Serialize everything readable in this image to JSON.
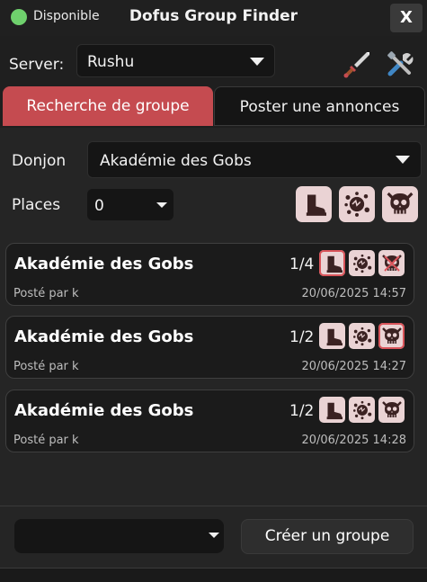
{
  "titlebar": {
    "status": "Disponible",
    "status_color": "#6fd06d",
    "title": "Dofus Group Finder",
    "close_label": "X"
  },
  "server": {
    "label": "Server:",
    "value": "Rushu",
    "icons": [
      "sword-icon",
      "tools-icon"
    ]
  },
  "tabs": [
    {
      "label": "Recherche de groupe",
      "active": true
    },
    {
      "label": "Poster une annonces",
      "active": false
    }
  ],
  "filters": {
    "donjon_label": "Donjon",
    "donjon_value": "Akadémie des Gobs",
    "places_label": "Places",
    "places_value": "0",
    "role_icons": [
      "boot-icon",
      "splat-icon",
      "skull-icon"
    ]
  },
  "listings": [
    {
      "title": "Akadémie des Gobs",
      "count": "1/4",
      "author": "Posté par k",
      "date": "20/06/2025 14:57"
    },
    {
      "title": "Akadémie des Gobs",
      "count": "1/2",
      "author": "Posté par k",
      "date": "20/06/2025 14:27"
    },
    {
      "title": "Akadémie des Gobs",
      "count": "1/2",
      "author": "Posté par k",
      "date": "20/06/2025 14:28"
    }
  ],
  "footer": {
    "select_value": "",
    "create_label": "Créer un groupe"
  },
  "colors": {
    "accent": "#c54b50",
    "background": "#252525",
    "role_bg": "#ead3d4"
  }
}
